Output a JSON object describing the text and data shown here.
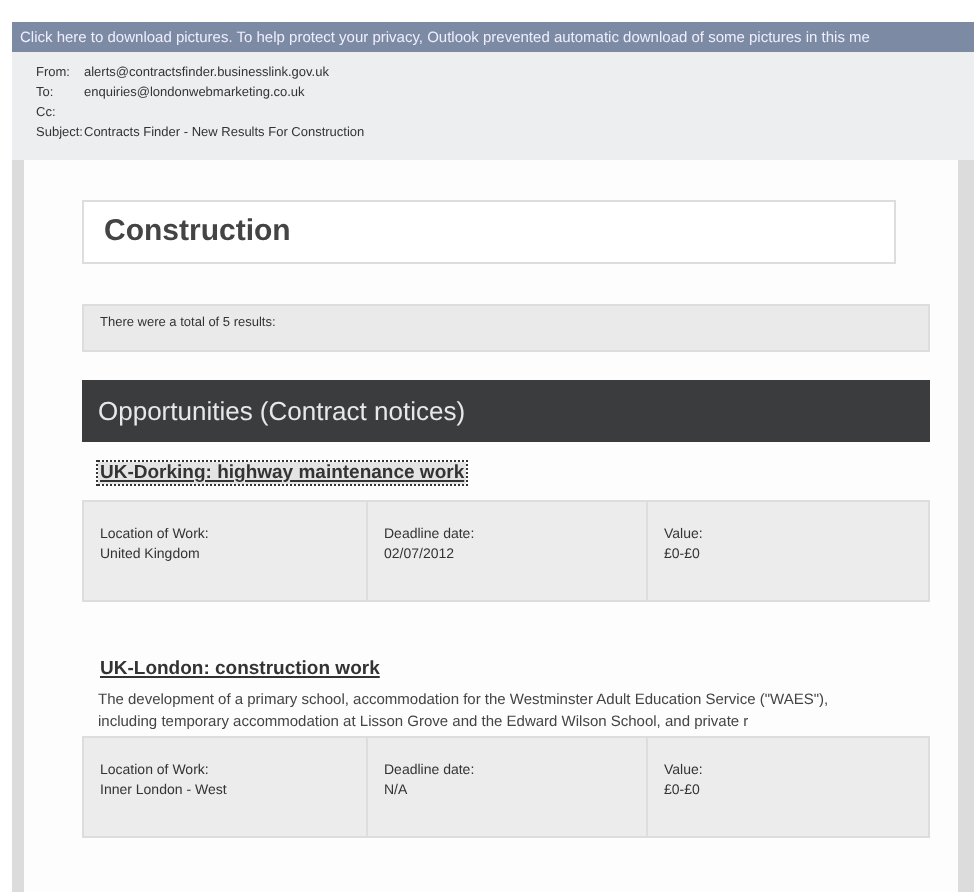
{
  "info_bar": {
    "text": "Click here to download pictures. To help protect your privacy, Outlook prevented automatic download of some pictures in this me"
  },
  "header": [
    {
      "label": "From:",
      "value": "alerts@contractsfinder.businesslink.gov.uk"
    },
    {
      "label": "To:",
      "value": "enquiries@londonwebmarketing.co.uk"
    },
    {
      "label": "Cc:"
    },
    {
      "label": "Subject:",
      "value": "Contracts Finder - New Results For Construction"
    }
  ],
  "title": "Construction",
  "results_text": "There were a total of 5 results:",
  "section_title": "Opportunities (Contract notices)",
  "notices": [
    {
      "title": "UK-Dorking: highway maintenance work",
      "selected": true,
      "fields": [
        {
          "label": "Location of Work:",
          "value": "United Kingdom"
        },
        {
          "label": "Deadline date:",
          "value": "02/07/2012"
        },
        {
          "label": "Value:",
          "value": "£0-£0"
        }
      ]
    },
    {
      "title": "UK-London: construction work",
      "selected": false,
      "description": "The development of a primary school, accommodation for the Westminster Adult Education Service (\"WAES\"), including temporary accommodation at Lisson Grove and the Edward Wilson School, and private r",
      "fields": [
        {
          "label": "Location of Work:",
          "value": "Inner London - West"
        },
        {
          "label": "Deadline date:",
          "value": "N/A"
        },
        {
          "label": "Value:",
          "value": "£0-£0"
        }
      ]
    }
  ]
}
